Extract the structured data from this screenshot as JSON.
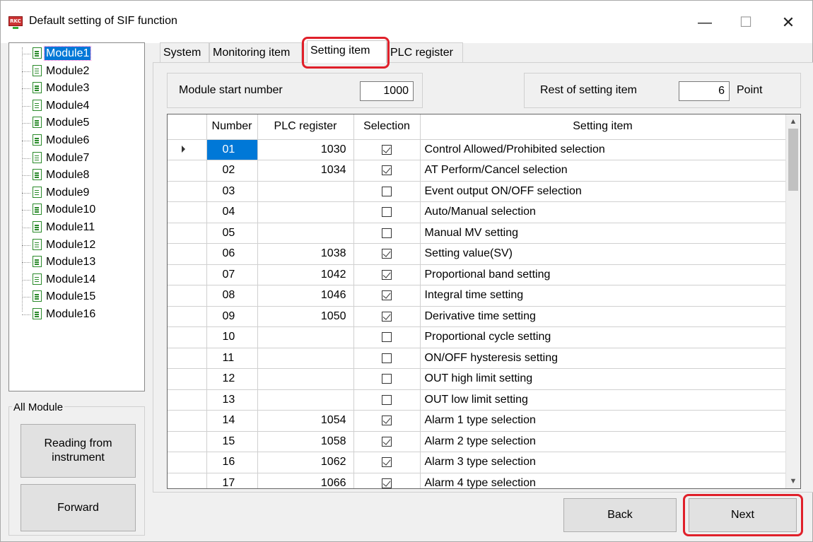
{
  "window": {
    "title": "Default setting of SIF function",
    "icon_text": "RKC",
    "minimize": "—",
    "maximize": "☐",
    "close": "✕"
  },
  "tree": {
    "items": [
      "Module1",
      "Module2",
      "Module3",
      "Module4",
      "Module5",
      "Module6",
      "Module7",
      "Module8",
      "Module9",
      "Module10",
      "Module11",
      "Module12",
      "Module13",
      "Module14",
      "Module15",
      "Module16"
    ],
    "selected": "Module1"
  },
  "all_module": {
    "label": "All Module",
    "read_button": "Reading from instrument",
    "forward_button": "Forward"
  },
  "tabs": {
    "system": "System",
    "monitoring": "Monitoring item",
    "setting": "Setting item",
    "plc": "PLC register",
    "active": "Setting item"
  },
  "module_start": {
    "label": "Module start number",
    "value": "1000"
  },
  "rest": {
    "label": "Rest of setting item",
    "value": "6",
    "unit": "Point"
  },
  "grid": {
    "headers": {
      "number": "Number",
      "plc": "PLC register",
      "selection": "Selection",
      "item": "Setting item"
    },
    "rows": [
      {
        "number": "01",
        "plc": "1030",
        "selected": true,
        "item": "Control Allowed/Prohibited selection"
      },
      {
        "number": "02",
        "plc": "1034",
        "selected": true,
        "item": "AT Perform/Cancel selection"
      },
      {
        "number": "03",
        "plc": "",
        "selected": false,
        "item": "Event output ON/OFF selection"
      },
      {
        "number": "04",
        "plc": "",
        "selected": false,
        "item": "Auto/Manual selection"
      },
      {
        "number": "05",
        "plc": "",
        "selected": false,
        "item": "Manual MV setting"
      },
      {
        "number": "06",
        "plc": "1038",
        "selected": true,
        "item": "Setting value(SV)"
      },
      {
        "number": "07",
        "plc": "1042",
        "selected": true,
        "item": "Proportional band setting"
      },
      {
        "number": "08",
        "plc": "1046",
        "selected": true,
        "item": "Integral time setting"
      },
      {
        "number": "09",
        "plc": "1050",
        "selected": true,
        "item": "Derivative time setting"
      },
      {
        "number": "10",
        "plc": "",
        "selected": false,
        "item": "Proportional cycle setting"
      },
      {
        "number": "11",
        "plc": "",
        "selected": false,
        "item": "ON/OFF hysteresis setting"
      },
      {
        "number": "12",
        "plc": "",
        "selected": false,
        "item": "OUT high limit setting"
      },
      {
        "number": "13",
        "plc": "",
        "selected": false,
        "item": "OUT low limit setting"
      },
      {
        "number": "14",
        "plc": "1054",
        "selected": true,
        "item": "Alarm 1 type selection"
      },
      {
        "number": "15",
        "plc": "1058",
        "selected": true,
        "item": "Alarm 2 type selection"
      },
      {
        "number": "16",
        "plc": "1062",
        "selected": true,
        "item": "Alarm 3 type selection"
      },
      {
        "number": "17",
        "plc": "1066",
        "selected": true,
        "item": "Alarm 4 type selection"
      }
    ]
  },
  "footer": {
    "back": "Back",
    "next": "Next"
  }
}
